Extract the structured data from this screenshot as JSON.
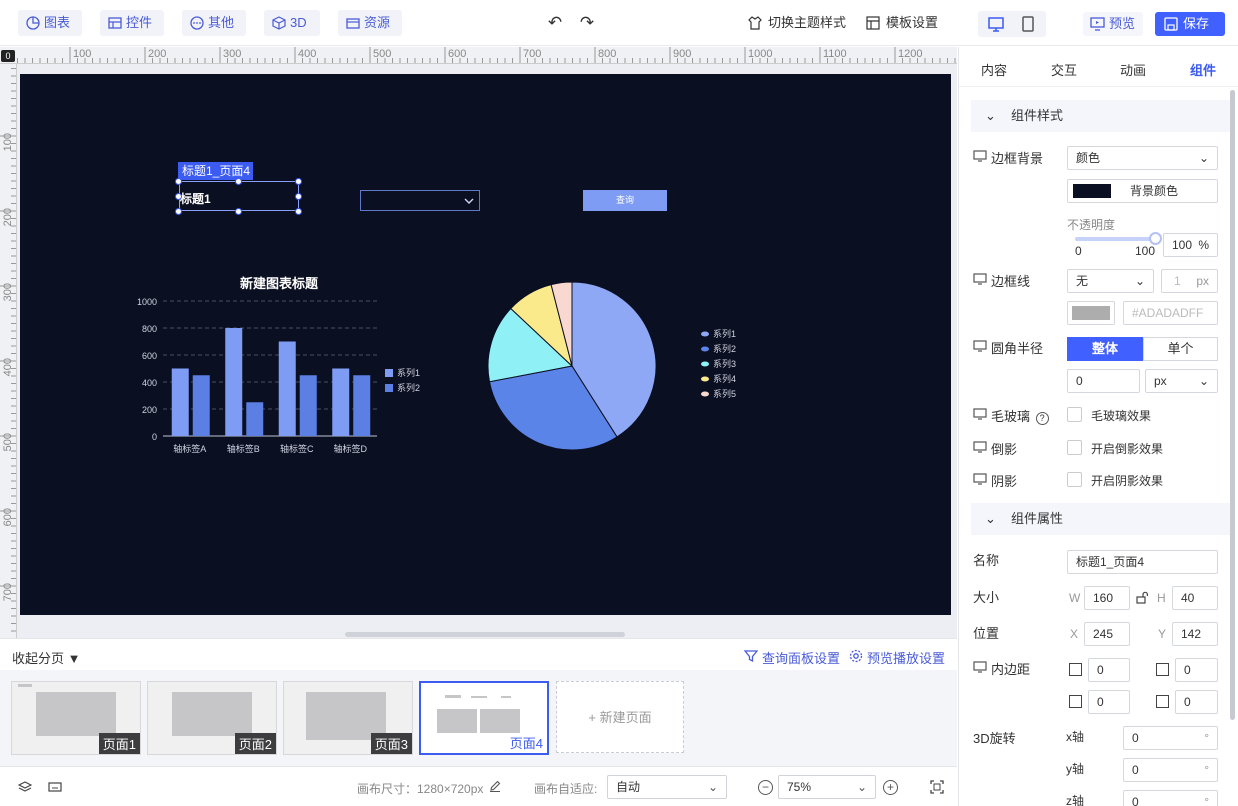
{
  "toolbar": {
    "tools": [
      "图表",
      "控件",
      "其他",
      "3D",
      "资源"
    ],
    "theme_label": "切换主题样式",
    "template_label": "模板设置",
    "preview_label": "预览",
    "save_label": "保存"
  },
  "rulers": {
    "top": [
      "100",
      "200",
      "300",
      "400",
      "500",
      "600",
      "700",
      "800",
      "900",
      "1000",
      "1100",
      "1200"
    ],
    "left": [
      "100",
      "200",
      "300",
      "400",
      "500",
      "600",
      "700"
    ],
    "corner": "0"
  },
  "canvas": {
    "selection_tag": "标题1_页面4",
    "selected_text": "标题1",
    "query_button": "查询"
  },
  "chart_data": [
    {
      "type": "bar",
      "title": "新建图表标题",
      "categories": [
        "轴标签A",
        "轴标签B",
        "轴标签C",
        "轴标签D"
      ],
      "series": [
        {
          "name": "系列1",
          "values": [
            500,
            800,
            700,
            500
          ]
        },
        {
          "name": "系列2",
          "values": [
            450,
            250,
            450,
            450
          ]
        }
      ],
      "ylim": [
        0,
        1000
      ],
      "yticks": [
        "0",
        "200",
        "400",
        "600",
        "800",
        "1000"
      ],
      "grid": true,
      "legend": "right",
      "colors": [
        "#7f9cf5",
        "#5b7fe3"
      ]
    },
    {
      "type": "pie",
      "categories": [
        "系列1",
        "系列2",
        "系列3",
        "系列4",
        "系列5"
      ],
      "values": [
        41,
        31,
        15,
        9,
        4
      ],
      "legend": "right",
      "colors": [
        "#8ea8f5",
        "#5b84e8",
        "#8ff0f5",
        "#fbea8b",
        "#f8d8cf"
      ]
    }
  ],
  "pages": {
    "collapse_label": "收起分页",
    "query_panel_label": "查询面板设置",
    "preview_play_label": "预览播放设置",
    "items": [
      "页面1",
      "页面2",
      "页面3",
      "页面4"
    ],
    "new_page_label": "新建页面"
  },
  "status": {
    "canvas_size_label": "画布尺寸：1280×720px",
    "fit_label": "画布自适应:",
    "fit_value": "自动",
    "zoom_value": "75%"
  },
  "panel": {
    "tabs": [
      "内容",
      "交互",
      "动画",
      "组件"
    ],
    "style_section": "组件样式",
    "border_bg_label": "边框背景",
    "border_bg_value": "颜色",
    "bg_color_label": "背景颜色",
    "opacity_label": "不透明度",
    "opacity_min": "0",
    "opacity_max": "100",
    "opacity_value": "100",
    "percent": "%",
    "border_line_label": "边框线",
    "border_line_value": "无",
    "border_width": "1",
    "px_unit": "px",
    "border_color_hex": "#ADADADFF",
    "radius_label": "圆角半径",
    "radius_whole": "整体",
    "radius_single": "单个",
    "radius_value": "0",
    "radius_unit": "px",
    "frost_label": "毛玻璃",
    "frost_check": "毛玻璃效果",
    "reflect_label": "倒影",
    "reflect_check": "开启倒影效果",
    "shadow_label": "阴影",
    "shadow_check": "开启阴影效果",
    "attr_section": "组件属性",
    "name_label": "名称",
    "name_value": "标题1_页面4",
    "size_label": "大小",
    "w_label": "W",
    "w_value": "160",
    "h_label": "H",
    "h_value": "40",
    "pos_label": "位置",
    "x_label": "X",
    "x_value": "245",
    "y_label": "Y",
    "y_value": "142",
    "padding_label": "内边距",
    "pad_values": [
      "0",
      "0",
      "0",
      "0"
    ],
    "rotate_label": "3D旋转",
    "x_axis_label": "x轴",
    "x_axis_value": "0",
    "y_axis_label": "y轴",
    "y_axis_value": "0",
    "z_axis_label": "z轴",
    "z_axis_value": "0",
    "degree": "°"
  },
  "colors": {
    "accent": "#4060ff",
    "canvas_bg": "#0b0f22"
  }
}
